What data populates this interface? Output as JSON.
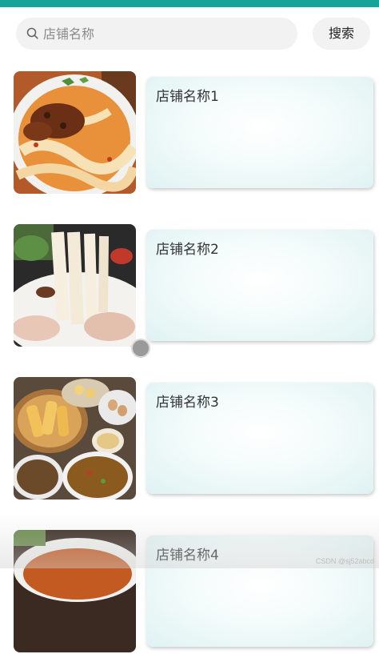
{
  "search": {
    "placeholder": "店铺名称",
    "value": "",
    "button_label": "搜索"
  },
  "shops": [
    {
      "name": "店铺名称1",
      "image": "noodle-soup-with-braised-meat"
    },
    {
      "name": "店铺名称2",
      "image": "wide-noodles-with-chopsticks"
    },
    {
      "name": "店铺名称3",
      "image": "breakfast-fried-dough-and-soup"
    },
    {
      "name": "店铺名称4",
      "image": "noodle-soup-bowl"
    }
  ],
  "watermark": "CSDN @sj52abcd",
  "colors": {
    "top_bar": "#16a39a",
    "card_tint": "#dff2f2"
  }
}
